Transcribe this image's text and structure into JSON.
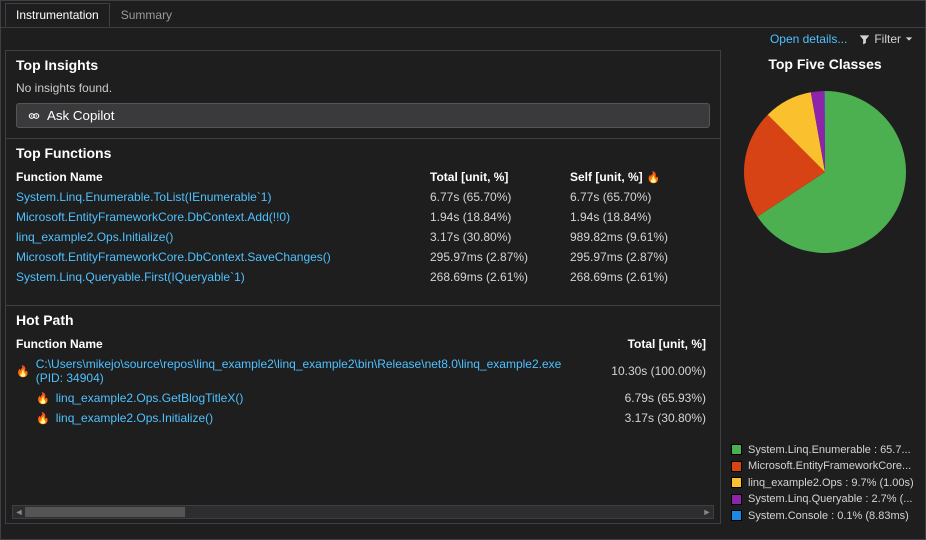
{
  "tabs": {
    "instrumentation": "Instrumentation",
    "summary": "Summary"
  },
  "toolbar": {
    "open_details": "Open details...",
    "filter": "Filter"
  },
  "insights": {
    "title": "Top Insights",
    "none": "No insights found.",
    "ask_copilot": "Ask Copilot"
  },
  "functions": {
    "title": "Top Functions",
    "col_name": "Function Name",
    "col_total": "Total [unit, %]",
    "col_self": "Self [unit, %]",
    "rows": [
      {
        "name": "System.Linq.Enumerable.ToList(IEnumerable`1)",
        "total": "6.77s (65.70%)",
        "self": "6.77s (65.70%)"
      },
      {
        "name": "Microsoft.EntityFrameworkCore.DbContext.Add(!!0)",
        "total": "1.94s (18.84%)",
        "self": "1.94s (18.84%)"
      },
      {
        "name": "linq_example2.Ops.Initialize()",
        "total": "3.17s (30.80%)",
        "self": "989.82ms (9.61%)"
      },
      {
        "name": "Microsoft.EntityFrameworkCore.DbContext.SaveChanges()",
        "total": "295.97ms (2.87%)",
        "self": "295.97ms (2.87%)"
      },
      {
        "name": "System.Linq.Queryable.First(IQueryable`1)",
        "total": "268.69ms (2.61%)",
        "self": "268.69ms (2.61%)"
      }
    ]
  },
  "hotpath": {
    "title": "Hot Path",
    "col_name": "Function Name",
    "col_total": "Total [unit, %]",
    "rows": [
      {
        "indent": 0,
        "name": "C:\\Users\\mikejo\\source\\repos\\linq_example2\\linq_example2\\bin\\Release\\net8.0\\linq_example2.exe (PID: 34904)",
        "total": "10.30s (100.00%)"
      },
      {
        "indent": 1,
        "name": "linq_example2.Ops.GetBlogTitleX()",
        "total": "6.79s (65.93%)"
      },
      {
        "indent": 1,
        "name": "linq_example2.Ops.Initialize()",
        "total": "3.17s (30.80%)"
      }
    ]
  },
  "right": {
    "title": "Top Five Classes",
    "legend": [
      {
        "color": "#4caf50",
        "label": "System.Linq.Enumerable : 65.7..."
      },
      {
        "color": "#d84315",
        "label": "Microsoft.EntityFrameworkCore..."
      },
      {
        "color": "#fbc02d",
        "label": "linq_example2.Ops : 9.7% (1.00s)"
      },
      {
        "color": "#8e24aa",
        "label": "System.Linq.Queryable : 2.7% (..."
      },
      {
        "color": "#1e88e5",
        "label": "System.Console : 0.1% (8.83ms)"
      }
    ]
  },
  "chart_data": {
    "type": "pie",
    "title": "Top Five Classes",
    "series": [
      {
        "name": "System.Linq.Enumerable",
        "value": 65.7,
        "color": "#4caf50"
      },
      {
        "name": "Microsoft.EntityFrameworkCore",
        "value": 21.8,
        "color": "#d84315"
      },
      {
        "name": "linq_example2.Ops",
        "value": 9.7,
        "color": "#fbc02d"
      },
      {
        "name": "System.Linq.Queryable",
        "value": 2.7,
        "color": "#8e24aa"
      },
      {
        "name": "System.Console",
        "value": 0.1,
        "color": "#1e88e5"
      }
    ]
  }
}
